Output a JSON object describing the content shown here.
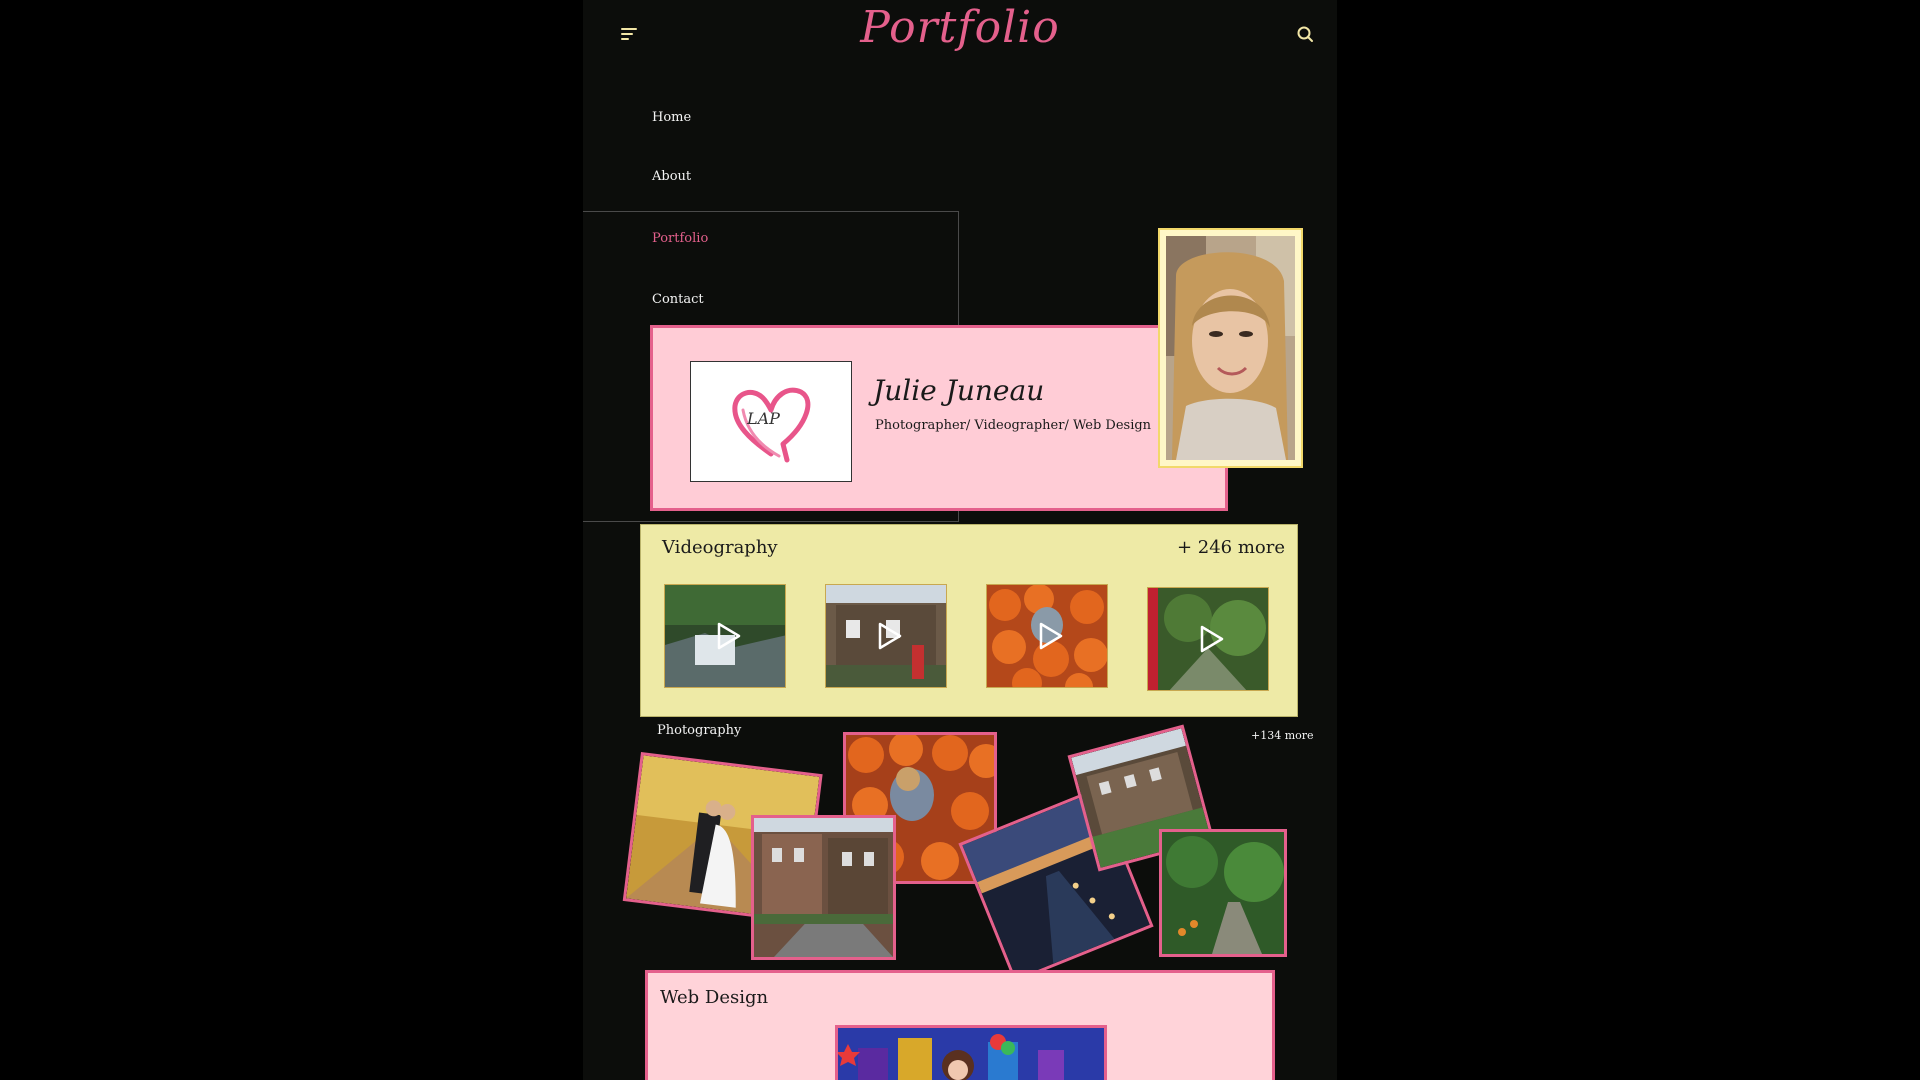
{
  "header": {
    "site_title": "Portfolio",
    "menu_icon": "hamburger-menu-icon",
    "search_icon": "search-icon"
  },
  "nav": {
    "items": [
      {
        "label": "Home",
        "active": false
      },
      {
        "label": "About",
        "active": false
      },
      {
        "label": "Portfolio",
        "active": true
      },
      {
        "label": "Contact",
        "active": false
      }
    ]
  },
  "profile": {
    "name": "Julie Juneau",
    "subtitle": "Photographer/ Videographer/ Web Design",
    "logo_text": "LAP"
  },
  "videography": {
    "title": "Videography",
    "more": "+ 246 more"
  },
  "photography": {
    "title": "Photography",
    "more": "+134 more"
  },
  "web_design": {
    "title": "Web Design"
  },
  "colors": {
    "page_bg": "#0c0d0b",
    "accent_pink": "#e4608c",
    "profile_bg": "#ffccd6",
    "video_bg": "#eeeaa6",
    "icon_yellow": "#f2e6a6"
  }
}
